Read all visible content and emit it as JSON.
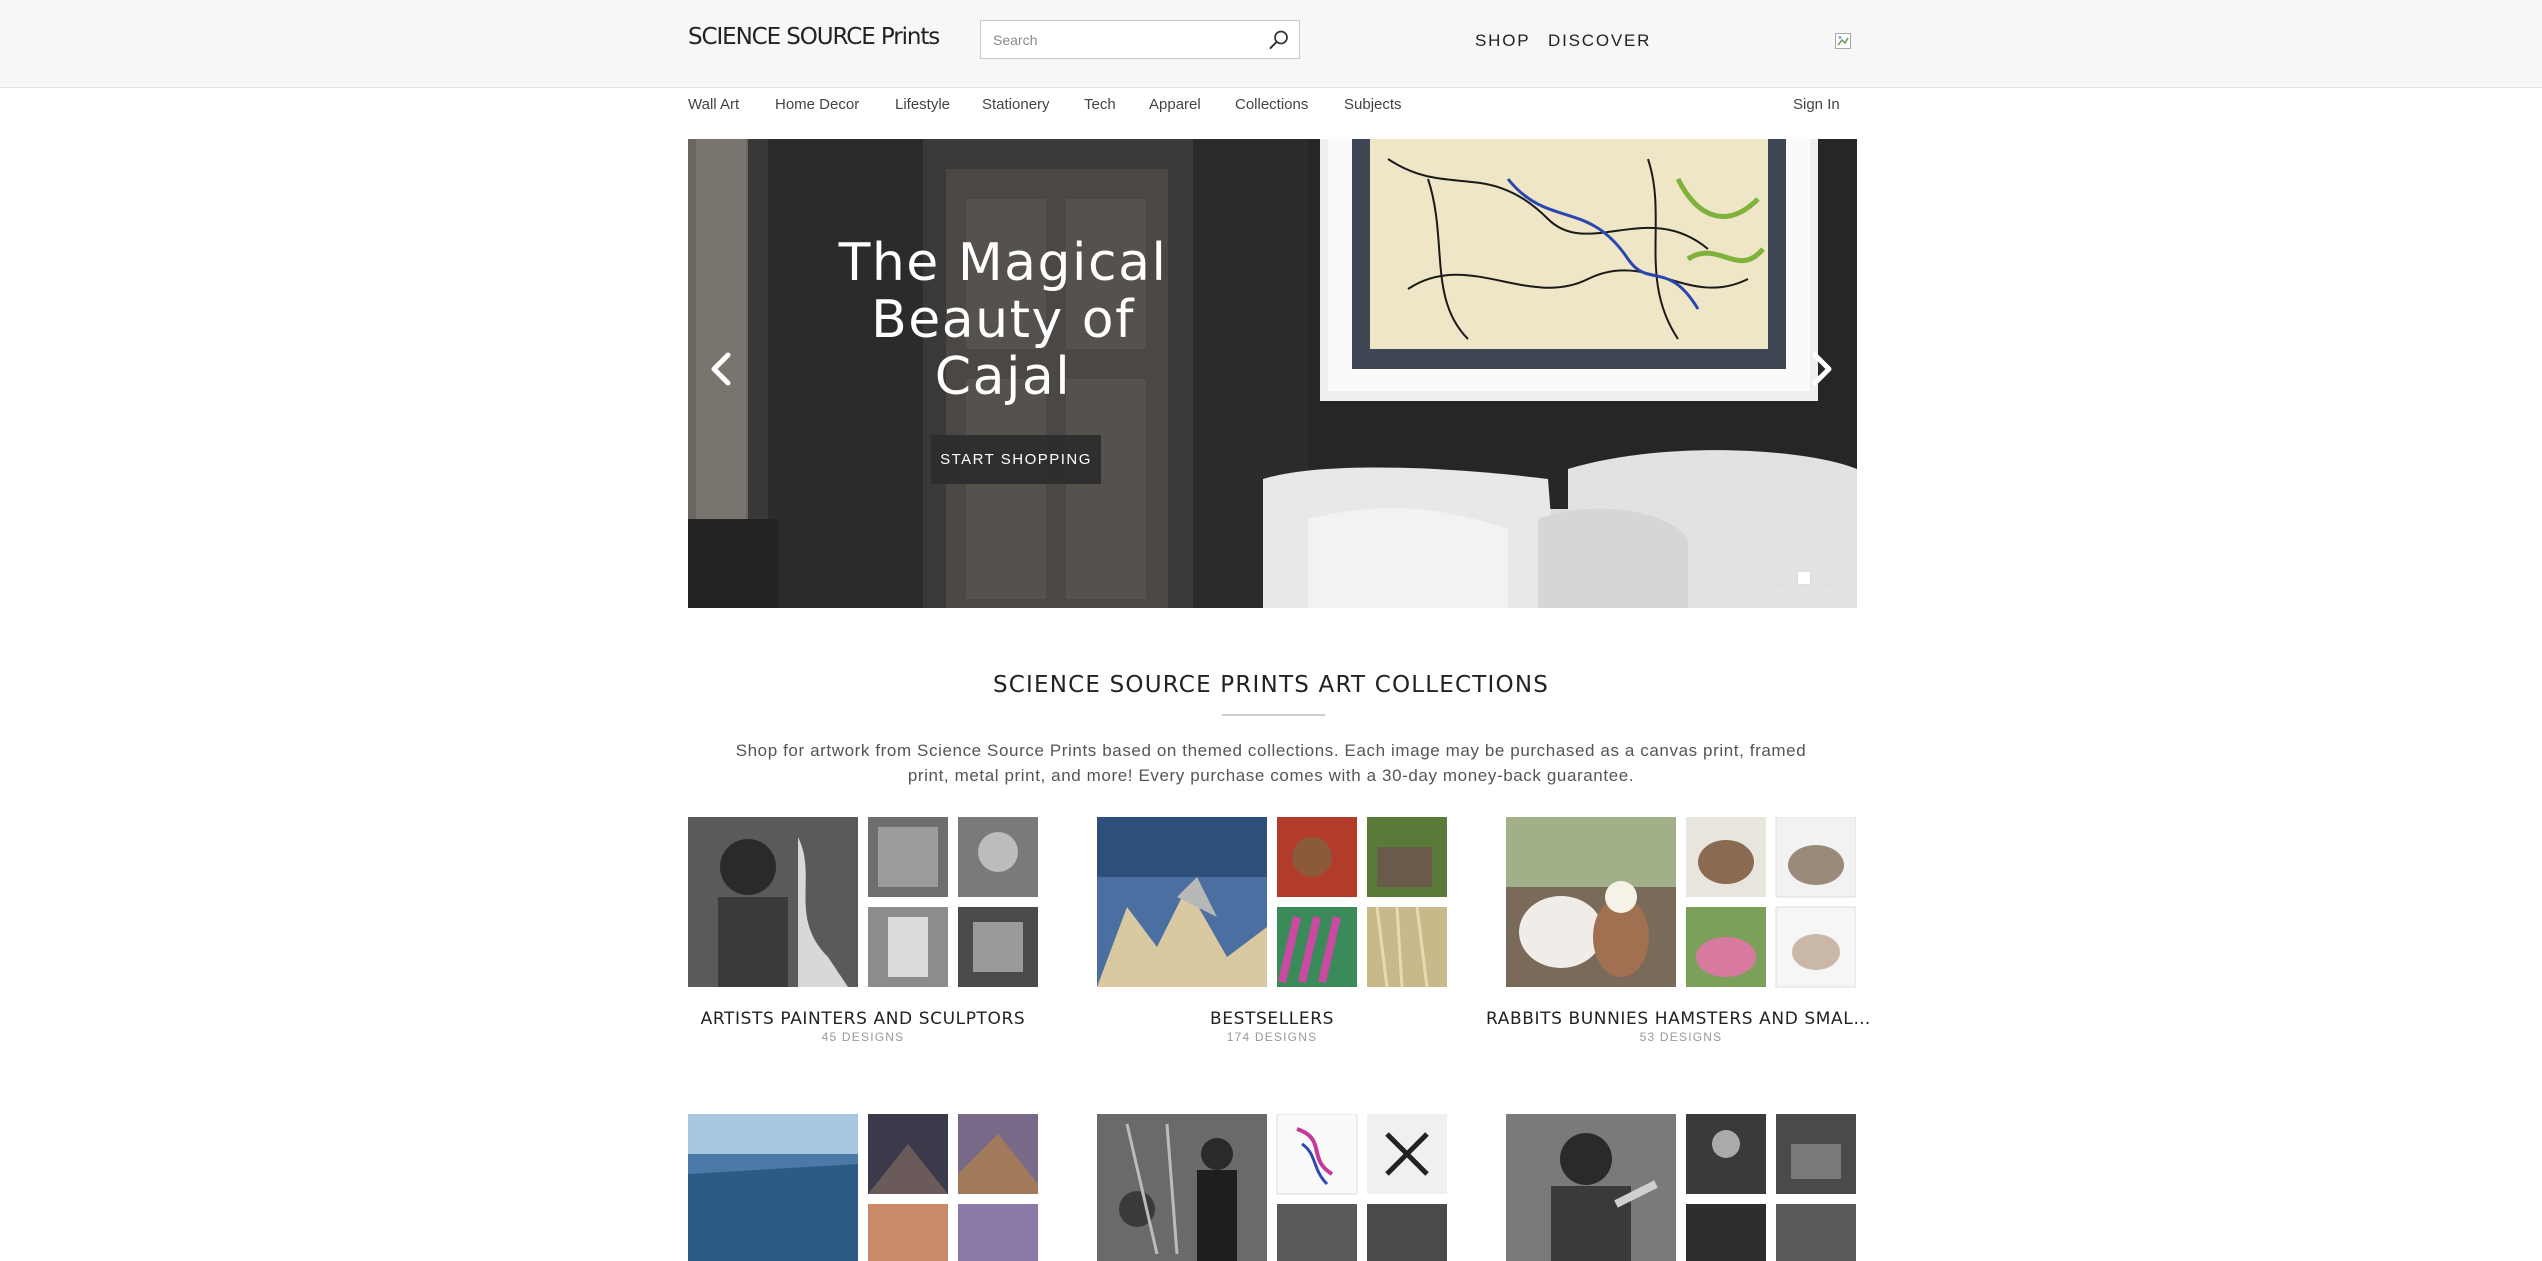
{
  "header": {
    "logo_bold": "SCIENCE SOURCE",
    "logo_rest": " Prints",
    "search_placeholder": "Search",
    "nav": [
      "SHOP",
      "DISCOVER"
    ]
  },
  "categories": [
    "Wall Art",
    "Home Decor",
    "Lifestyle",
    "Stationery",
    "Tech",
    "Apparel",
    "Collections",
    "Subjects"
  ],
  "account": {
    "sign_in": "Sign In"
  },
  "hero": {
    "title": "The Magical Beauty of Cajal",
    "button": "START SHOPPING",
    "slides": 3,
    "active_slide": 2
  },
  "section": {
    "title": "SCIENCE SOURCE PRINTS ART COLLECTIONS",
    "description": "Shop for artwork from Science Source Prints based on themed collections. Each image may be purchased as a canvas print, framed print, metal print, and more! Every purchase comes with a 30-day money-back guarantee."
  },
  "collections": [
    {
      "name": "ARTISTS PAINTERS AND SCULPTORS",
      "count": "45 DESIGNS"
    },
    {
      "name": "BESTSELLERS",
      "count": "174 DESIGNS"
    },
    {
      "name": "RABBITS BUNNIES HAMSTERS AND SMALL PETS",
      "count": "53 DESIGNS"
    },
    {
      "name": "",
      "count": ""
    },
    {
      "name": "",
      "count": ""
    },
    {
      "name": "",
      "count": ""
    }
  ],
  "icons": {
    "search": "magnifier-icon",
    "cart": "cart-icon",
    "prev": "chevron-left-icon",
    "next": "chevron-right-icon"
  },
  "colors": {
    "header_bg": "#f7f7f7",
    "hero_button": "#2d2d2d",
    "text": "#222222"
  }
}
